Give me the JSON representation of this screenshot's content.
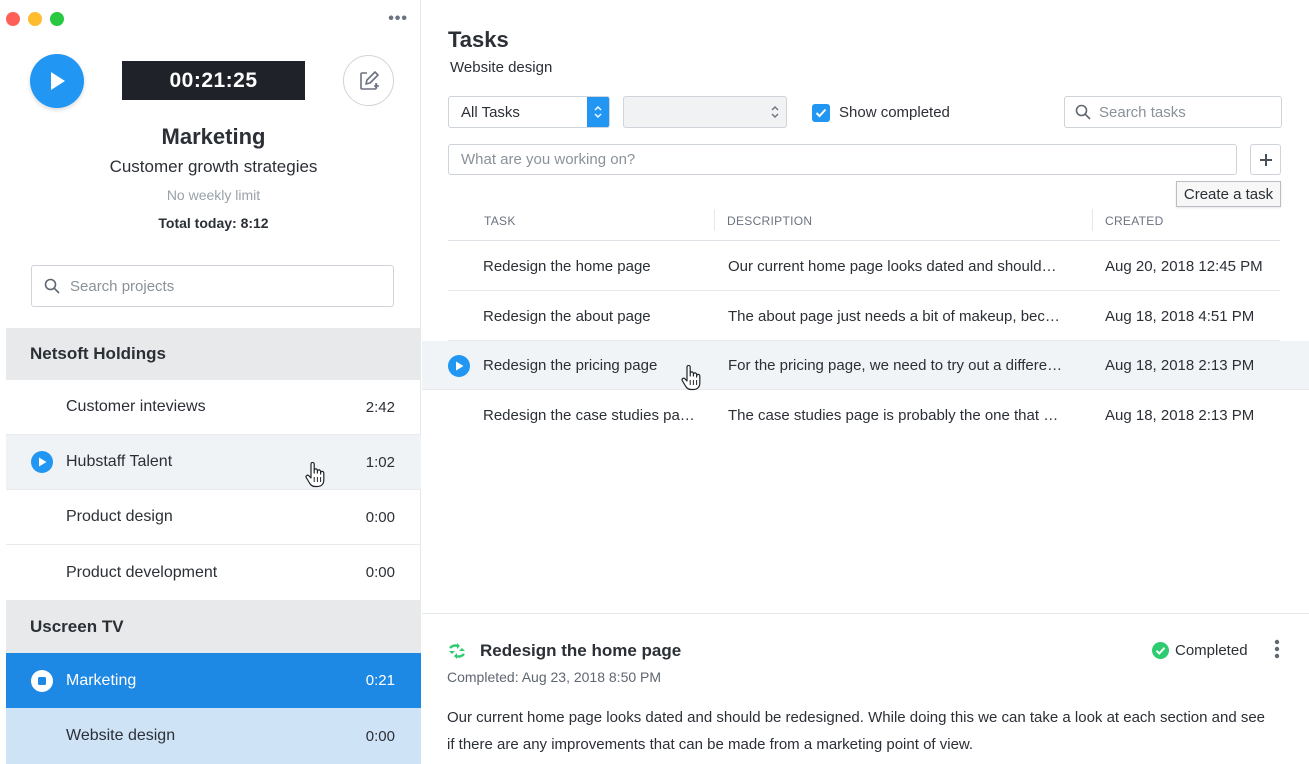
{
  "timer": {
    "value": "00:21:25"
  },
  "current_project": {
    "title": "Marketing",
    "subtitle": "Customer growth strategies",
    "limit": "No weekly limit",
    "total_today": "Total today: 8:12"
  },
  "sidebar": {
    "search_placeholder": "Search projects",
    "groups": [
      {
        "name": "Netsoft Holdings",
        "projects": [
          {
            "name": "Customer inteviews",
            "time": "2:42"
          },
          {
            "name": "Hubstaff Talent",
            "time": "1:02"
          },
          {
            "name": "Product design",
            "time": "0:00"
          },
          {
            "name": "Product development",
            "time": "0:00"
          }
        ]
      },
      {
        "name": "Uscreen TV",
        "projects": [
          {
            "name": "Marketing",
            "time": "0:21"
          },
          {
            "name": "Website design",
            "time": "0:00"
          }
        ]
      }
    ]
  },
  "tasks": {
    "title": "Tasks",
    "subtitle": "Website design",
    "filter_selected": "All Tasks",
    "show_completed_label": "Show completed",
    "show_completed_checked": true,
    "search_placeholder": "Search tasks",
    "new_task_placeholder": "What are you working on?",
    "tooltip": "Create a task",
    "columns": [
      "TASK",
      "DESCRIPTION",
      "CREATED"
    ],
    "rows": [
      {
        "task": "Redesign the home page",
        "description": "Our current home page looks dated and should…",
        "created": "Aug 20, 2018 12:45 PM"
      },
      {
        "task": "Redesign the about page",
        "description": "The about page just needs a bit of makeup, bec…",
        "created": "Aug 18, 2018 4:51 PM"
      },
      {
        "task": "Redesign the pricing page",
        "description": "For the pricing page, we need to try out a differe…",
        "created": "Aug 18, 2018 2:13 PM"
      },
      {
        "task": "Redesign the case studies pa…",
        "description": "The case studies page is probably the one that …",
        "created": "Aug 18, 2018 2:13 PM"
      }
    ]
  },
  "detail": {
    "title": "Redesign the home page",
    "completed_date": "Completed: Aug 23, 2018 8:50 PM",
    "status": "Completed",
    "description": "Our current home page looks dated and should be redesigned. While doing this we can take a look at each section and see if there are any improvements that can be made from a marketing point of view."
  },
  "colors": {
    "accent": "#2196f3",
    "active_row": "#1e88e5",
    "selected_sub_row": "#cfe3f7",
    "completed": "#2ecc71",
    "timer_bg": "#1f2329"
  }
}
